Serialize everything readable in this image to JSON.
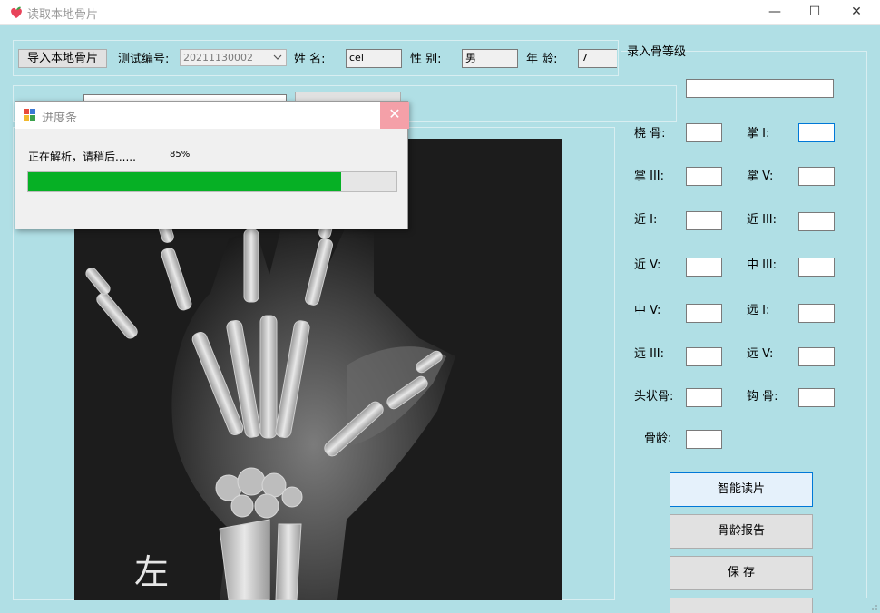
{
  "window": {
    "title": "读取本地骨片",
    "controls": {
      "minimize": "—",
      "maximize": "☐",
      "close": "✕"
    }
  },
  "toolbar": {
    "import_button": "导入本地骨片",
    "test_id_label": "测试编号:",
    "test_id_value": "20211130002",
    "name_label": "姓  名:",
    "name_value": "cel",
    "gender_label": "性  别:",
    "gender_value": "男",
    "age_label": "年  龄:",
    "age_value": "7"
  },
  "xray": {
    "side_label": "左"
  },
  "progress_dialog": {
    "title": "进度条",
    "message": "正在解析，请稍后......",
    "percent_text": "85%",
    "percent_value": 0.85,
    "close_symbol": "✕"
  },
  "grade_panel": {
    "title": "录入骨等级",
    "summary_value": "",
    "fields": [
      {
        "label": "桡  骨:",
        "value": ""
      },
      {
        "label": "掌  I:",
        "value": ""
      },
      {
        "label": "掌 III:",
        "value": ""
      },
      {
        "label": "掌  V:",
        "value": ""
      },
      {
        "label": "近  I:",
        "value": ""
      },
      {
        "label": "近 III:",
        "value": ""
      },
      {
        "label": "近  V:",
        "value": ""
      },
      {
        "label": "中 III:",
        "value": ""
      },
      {
        "label": "中  V:",
        "value": ""
      },
      {
        "label": "远  I:",
        "value": ""
      },
      {
        "label": "远 III:",
        "value": ""
      },
      {
        "label": "远  V:",
        "value": ""
      },
      {
        "label": "头状骨:",
        "value": ""
      },
      {
        "label": "钩  骨:",
        "value": ""
      }
    ],
    "bone_age_label": "骨龄:",
    "bone_age_value": ""
  },
  "actions": {
    "smart_read": "智能读片",
    "bone_age_report": "骨龄报告",
    "save": "保   存"
  },
  "colors": {
    "background": "#b0dfe5",
    "progress_fill": "#06b025",
    "dialog_close": "#f4a0a8",
    "focus_border": "#0078d7"
  }
}
